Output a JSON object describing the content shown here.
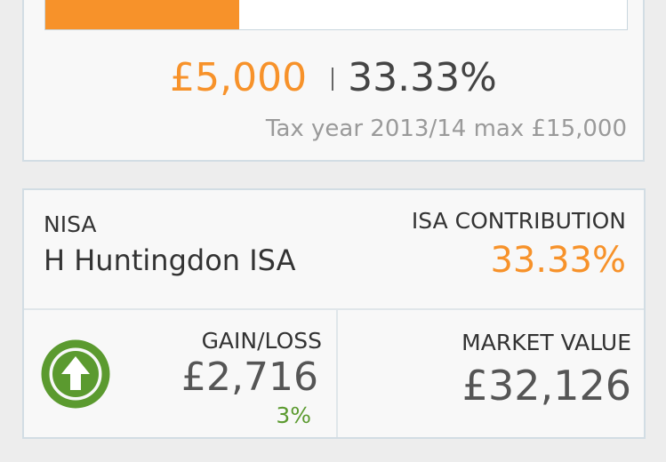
{
  "allowance": {
    "progress_fraction": 0.3333,
    "amount": "£5,000",
    "percent": "33.33%",
    "tax_note": "Tax year 2013/14 max £15,000"
  },
  "isa": {
    "type": "NISA",
    "name": "H Huntingdon ISA",
    "contribution_label": "ISA CONTRIBUTION",
    "contribution_value": "33.33%",
    "gain_label": "GAIN/LOSS",
    "gain_value": "£2,716",
    "gain_percent": "3%",
    "market_value_label": "MARKET VALUE",
    "market_value": "£32,126"
  },
  "icons": {
    "gain": "arrow-up-circle-icon"
  },
  "colors": {
    "accent_orange": "#f7922a",
    "gain_green": "#5b9a2f",
    "card_border": "#d2dde4"
  }
}
